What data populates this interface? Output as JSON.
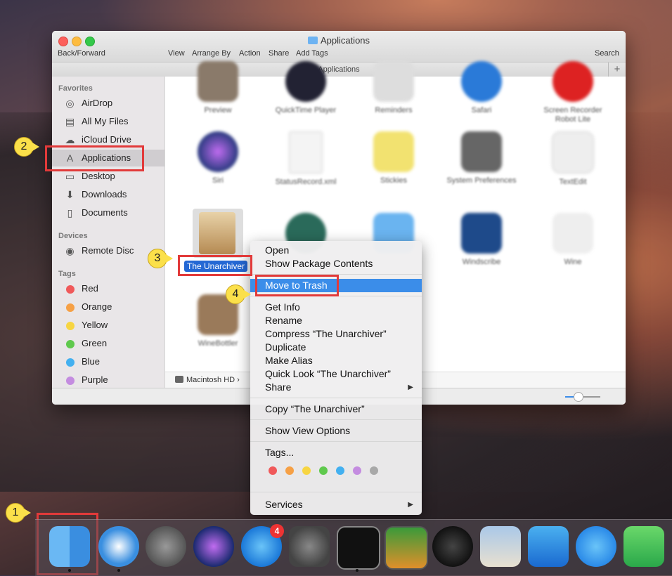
{
  "window": {
    "title": "Applications",
    "toolbar": [
      "Back/Forward",
      "View",
      "Arrange By",
      "Action",
      "Share",
      "Add Tags",
      "Search"
    ],
    "path_title": "Applications",
    "path_plus": "+"
  },
  "sidebar": {
    "favorites_head": "Favorites",
    "favorites": [
      {
        "label": "AirDrop",
        "icon": "airdrop-icon"
      },
      {
        "label": "All My Files",
        "icon": "all-files-icon"
      },
      {
        "label": "iCloud Drive",
        "icon": "cloud-icon"
      },
      {
        "label": "Applications",
        "icon": "applications-icon",
        "selected": true
      },
      {
        "label": "Desktop",
        "icon": "desktop-icon"
      },
      {
        "label": "Downloads",
        "icon": "downloads-icon"
      },
      {
        "label": "Documents",
        "icon": "documents-icon"
      }
    ],
    "devices_head": "Devices",
    "devices": [
      {
        "label": "Remote Disc",
        "icon": "disc-icon"
      }
    ],
    "tags_head": "Tags",
    "tags": [
      {
        "label": "Red",
        "color": "#f0595a"
      },
      {
        "label": "Orange",
        "color": "#f6a045"
      },
      {
        "label": "Yellow",
        "color": "#f7d542"
      },
      {
        "label": "Green",
        "color": "#5fc94d"
      },
      {
        "label": "Blue",
        "color": "#43b0f0"
      },
      {
        "label": "Purple",
        "color": "#c48ce0"
      }
    ]
  },
  "apps": [
    {
      "name": "Preview"
    },
    {
      "name": "QuickTime Player"
    },
    {
      "name": "Reminders"
    },
    {
      "name": "Safari"
    },
    {
      "name": "Screen Recorder Robot Lite"
    },
    {
      "name": "Siri"
    },
    {
      "name": "StatusRecord.xml"
    },
    {
      "name": "Stickies"
    },
    {
      "name": "System Preferences"
    },
    {
      "name": "TextEdit"
    },
    {
      "name": "Windscribe"
    },
    {
      "name": "Wine"
    },
    {
      "name": "WineBottler"
    }
  ],
  "selected_app": "The Unarchiver",
  "status_path": "Macintosh HD",
  "status_arrow": "›",
  "context_menu": {
    "items": [
      {
        "label": "Open"
      },
      {
        "label": "Show Package Contents"
      },
      {
        "label": "Move to Trash",
        "highlighted": true
      },
      {
        "label": "Get Info"
      },
      {
        "label": "Rename"
      },
      {
        "label": "Compress “The Unarchiver”"
      },
      {
        "label": "Duplicate"
      },
      {
        "label": "Make Alias"
      },
      {
        "label": "Quick Look “The Unarchiver”"
      },
      {
        "label": "Share",
        "submenu": true
      },
      {
        "label": "Copy “The Unarchiver”"
      },
      {
        "label": "Show View Options"
      },
      {
        "label": "Tags..."
      },
      {
        "label": "Services",
        "submenu": true
      }
    ],
    "tag_colors": [
      "#f0595a",
      "#f6a045",
      "#f7d542",
      "#5fc94d",
      "#43b0f0",
      "#c48ce0",
      "#a8a8a8"
    ],
    "submenu_arrow": "▶"
  },
  "callouts": [
    "1",
    "2",
    "3",
    "4"
  ],
  "dock": {
    "badge_count": "4",
    "icons": [
      "finder-icon",
      "safari-icon",
      "launchpad-icon",
      "siri-icon",
      "app-store-icon",
      "system-preferences-icon",
      "activity-monitor-icon",
      "mission-control-icon",
      "quicktime-icon",
      "preview-icon",
      "xcode-icon",
      "messages-icon",
      "facetime-icon"
    ]
  }
}
